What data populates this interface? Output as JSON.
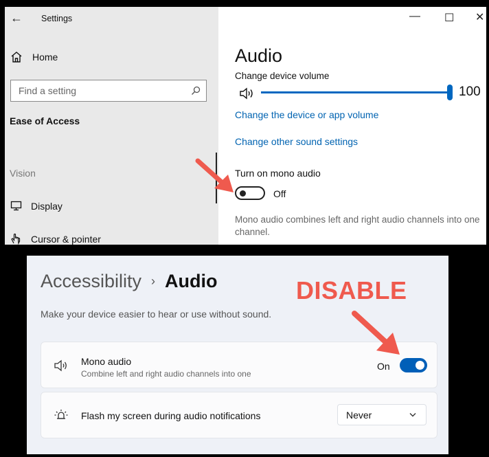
{
  "win10": {
    "app_title": "Settings",
    "home_label": "Home",
    "search_placeholder": "Find a setting",
    "category": "Ease of Access",
    "section_vision": "Vision",
    "nav": [
      "Display",
      "Cursor & pointer"
    ],
    "page_title": "Audio",
    "volume_label": "Change device volume",
    "volume_value": "100",
    "volume_level_percent": 100,
    "link_app_volume": "Change the device or app volume",
    "link_other_sound": "Change other sound settings",
    "mono_label": "Turn on mono audio",
    "mono_state": "Off",
    "mono_desc": "Mono audio combines left and right audio channels into one channel."
  },
  "win11": {
    "breadcrumb_parent": "Accessibility",
    "breadcrumb_sep": "›",
    "breadcrumb_current": "Audio",
    "subtitle": "Make your device easier to hear or use without sound.",
    "mono_title": "Mono audio",
    "mono_sub": "Combine left and right audio channels into one",
    "mono_state": "On",
    "flash_title": "Flash my screen during audio notifications",
    "flash_value": "Never"
  },
  "annotation": {
    "text": "DISABLE",
    "color": "#ef5a4e"
  },
  "colors": {
    "accent_win10": "#0067c0",
    "link_win10": "#0063b1",
    "accent_win11": "#005fb8"
  }
}
